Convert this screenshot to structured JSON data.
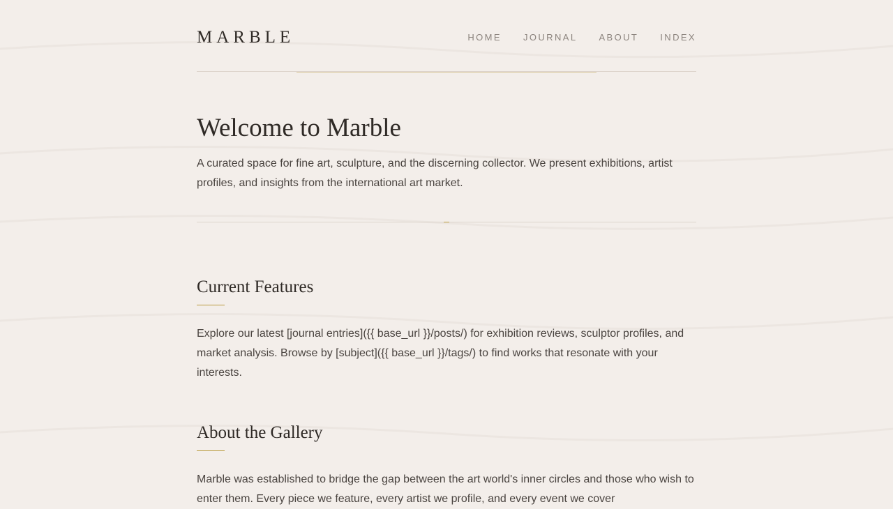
{
  "site": {
    "logo": "MARBLE"
  },
  "nav": {
    "items": [
      {
        "label": "HOME"
      },
      {
        "label": "JOURNAL"
      },
      {
        "label": "ABOUT"
      },
      {
        "label": "INDEX"
      }
    ]
  },
  "hero": {
    "title": "Welcome to Marble",
    "description": "A curated space for fine art, sculpture, and the discerning collector. We present exhibitions, artist profiles, and insights from the international art market."
  },
  "sections": [
    {
      "heading": "Current Features",
      "body": "Explore our latest [journal entries]({{ base_url }}/posts/) for exhibition reviews, sculptor profiles, and market analysis. Browse by [subject]({{ base_url }}/tags/) to find works that resonate with your interests."
    },
    {
      "heading": "About the Gallery",
      "body": "Marble was established to bridge the gap between the art world's inner circles and those who wish to enter them. Every piece we feature, every artist we profile, and every event we cover"
    }
  ],
  "colors": {
    "background": "#f3eeea",
    "accent_gold": "#b89a3c",
    "text_dark": "#2f2a26",
    "nav_gray": "#8b837d"
  }
}
